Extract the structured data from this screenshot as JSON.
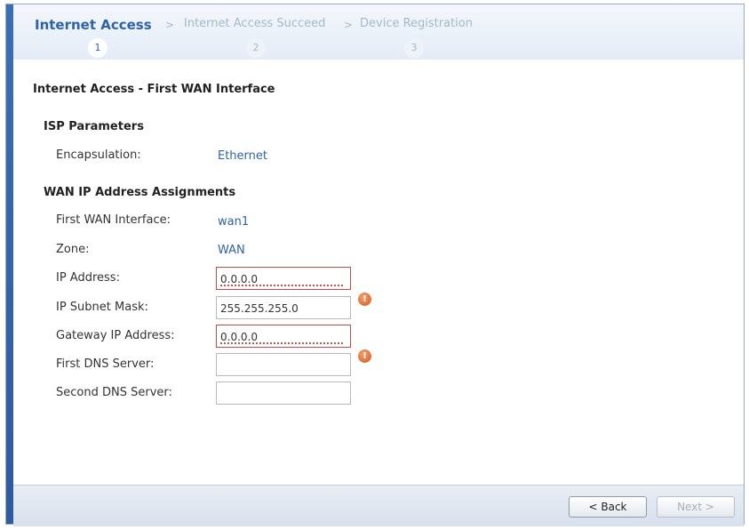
{
  "wizard": {
    "steps": [
      {
        "label": "Internet Access",
        "number": "1"
      },
      {
        "label": "Internet Access Succeed",
        "number": "2"
      },
      {
        "label": "Device Registration",
        "number": "3"
      }
    ],
    "separator": ">"
  },
  "page": {
    "title": "Internet Access - First WAN Interface"
  },
  "isp": {
    "heading": "ISP Parameters",
    "encapsulation_label": "Encapsulation:",
    "encapsulation_value": "Ethernet"
  },
  "wan": {
    "heading": "WAN IP Address Assignments",
    "interface_label": "First WAN Interface:",
    "interface_value": "wan1",
    "zone_label": "Zone:",
    "zone_value": "WAN",
    "ip_label": "IP Address:",
    "ip_value": "0.0.0.0",
    "mask_label": "IP Subnet Mask:",
    "mask_value": "255.255.255.0",
    "gateway_label": "Gateway IP Address:",
    "gateway_value": "0.0.0.0",
    "dns1_label": "First DNS Server:",
    "dns1_value": "",
    "dns2_label": "Second DNS Server:",
    "dns2_value": ""
  },
  "footer": {
    "back_label": "< Back",
    "next_label": "Next >"
  },
  "icons": {
    "warning": "warning-icon",
    "warning_glyph": "!"
  }
}
